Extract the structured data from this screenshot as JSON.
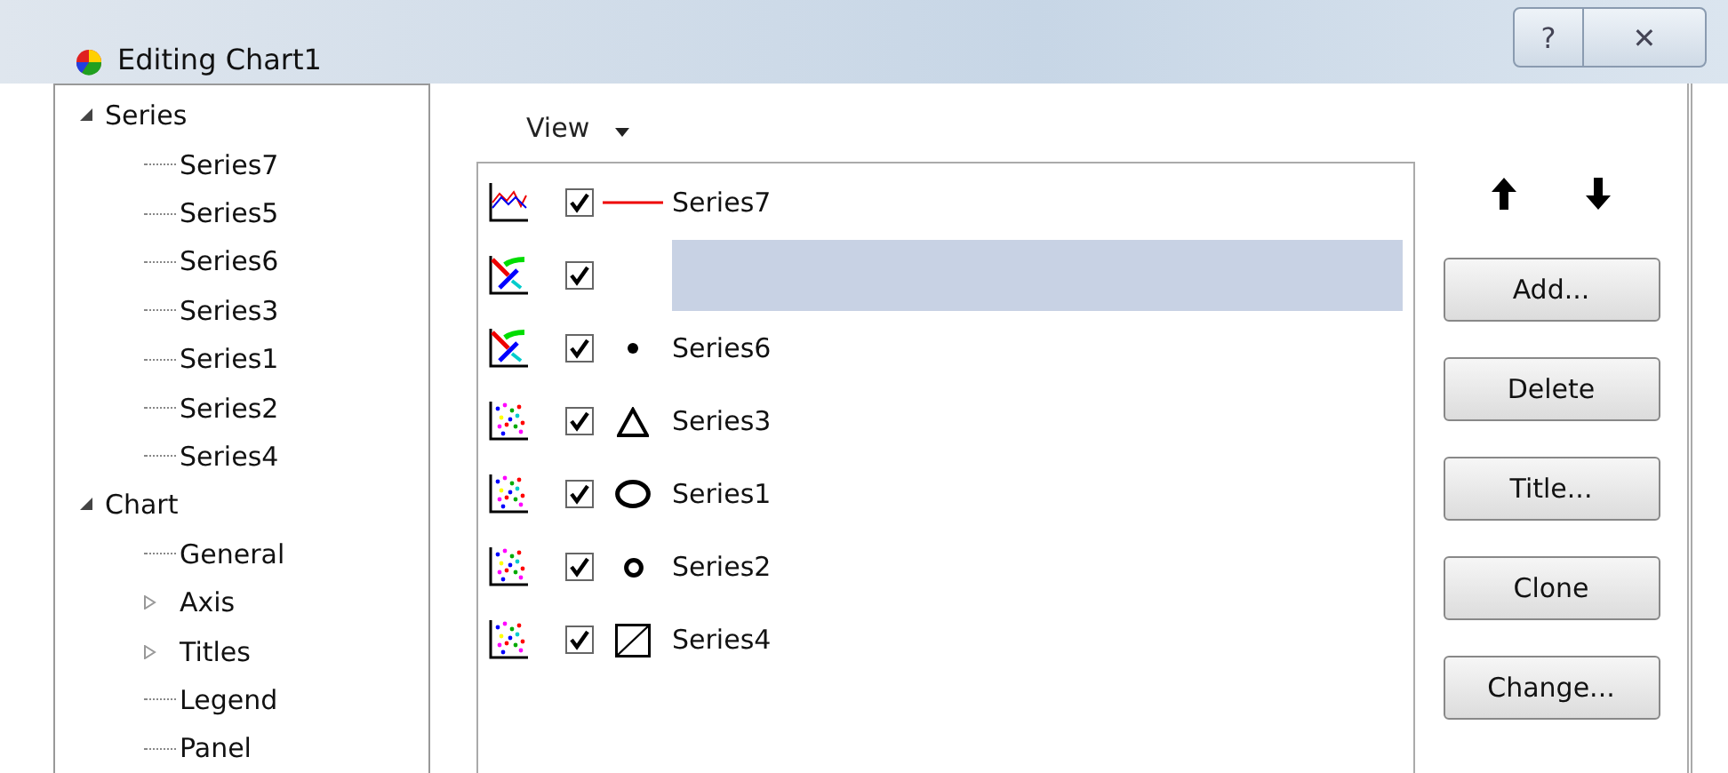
{
  "window": {
    "title": "Editing Chart1",
    "buttons": [
      "?",
      "✕"
    ]
  },
  "tree": [
    {
      "label": "Series",
      "expanded": true,
      "children": [
        {
          "label": "Series7"
        },
        {
          "label": "Series5"
        },
        {
          "label": "Series6"
        },
        {
          "label": "Series3"
        },
        {
          "label": "Series1"
        },
        {
          "label": "Series2"
        },
        {
          "label": "Series4"
        }
      ]
    },
    {
      "label": "Chart",
      "expanded": true,
      "children": [
        {
          "label": "General"
        },
        {
          "label": "Axis",
          "expanded": false
        },
        {
          "label": "Titles",
          "expanded": false
        },
        {
          "label": "Legend"
        },
        {
          "label": "Panel"
        }
      ]
    }
  ],
  "view_menu": {
    "label": "View"
  },
  "series": [
    {
      "gallery": {
        "kind": "line"
      },
      "checked": true,
      "marker": {
        "kind": "line"
      },
      "name": "Series7",
      "selected": false
    },
    {
      "gallery": {
        "kind": "arrow"
      },
      "checked": true,
      "selected": true
    },
    {
      "gallery": {
        "kind": "arrow"
      },
      "checked": true,
      "marker": {
        "kind": "dot"
      },
      "name": "Series6",
      "selected": false
    },
    {
      "gallery": {
        "kind": "points"
      },
      "checked": true,
      "marker": {
        "kind": "triangle"
      },
      "name": "Series3",
      "selected": false
    },
    {
      "gallery": {
        "kind": "points"
      },
      "checked": true,
      "marker": {
        "kind": "circle"
      },
      "name": "Series1",
      "selected": false
    },
    {
      "gallery": {
        "kind": "points"
      },
      "checked": true,
      "marker": {
        "kind": "ring"
      },
      "name": "Series2",
      "selected": false
    },
    {
      "gallery": {
        "kind": "points"
      },
      "checked": true,
      "marker": {
        "kind": "square"
      },
      "name": "Series4",
      "selected": false
    }
  ],
  "buttons": [
    "Add...",
    "Delete",
    "Title...",
    "Clone",
    "Change..."
  ]
}
